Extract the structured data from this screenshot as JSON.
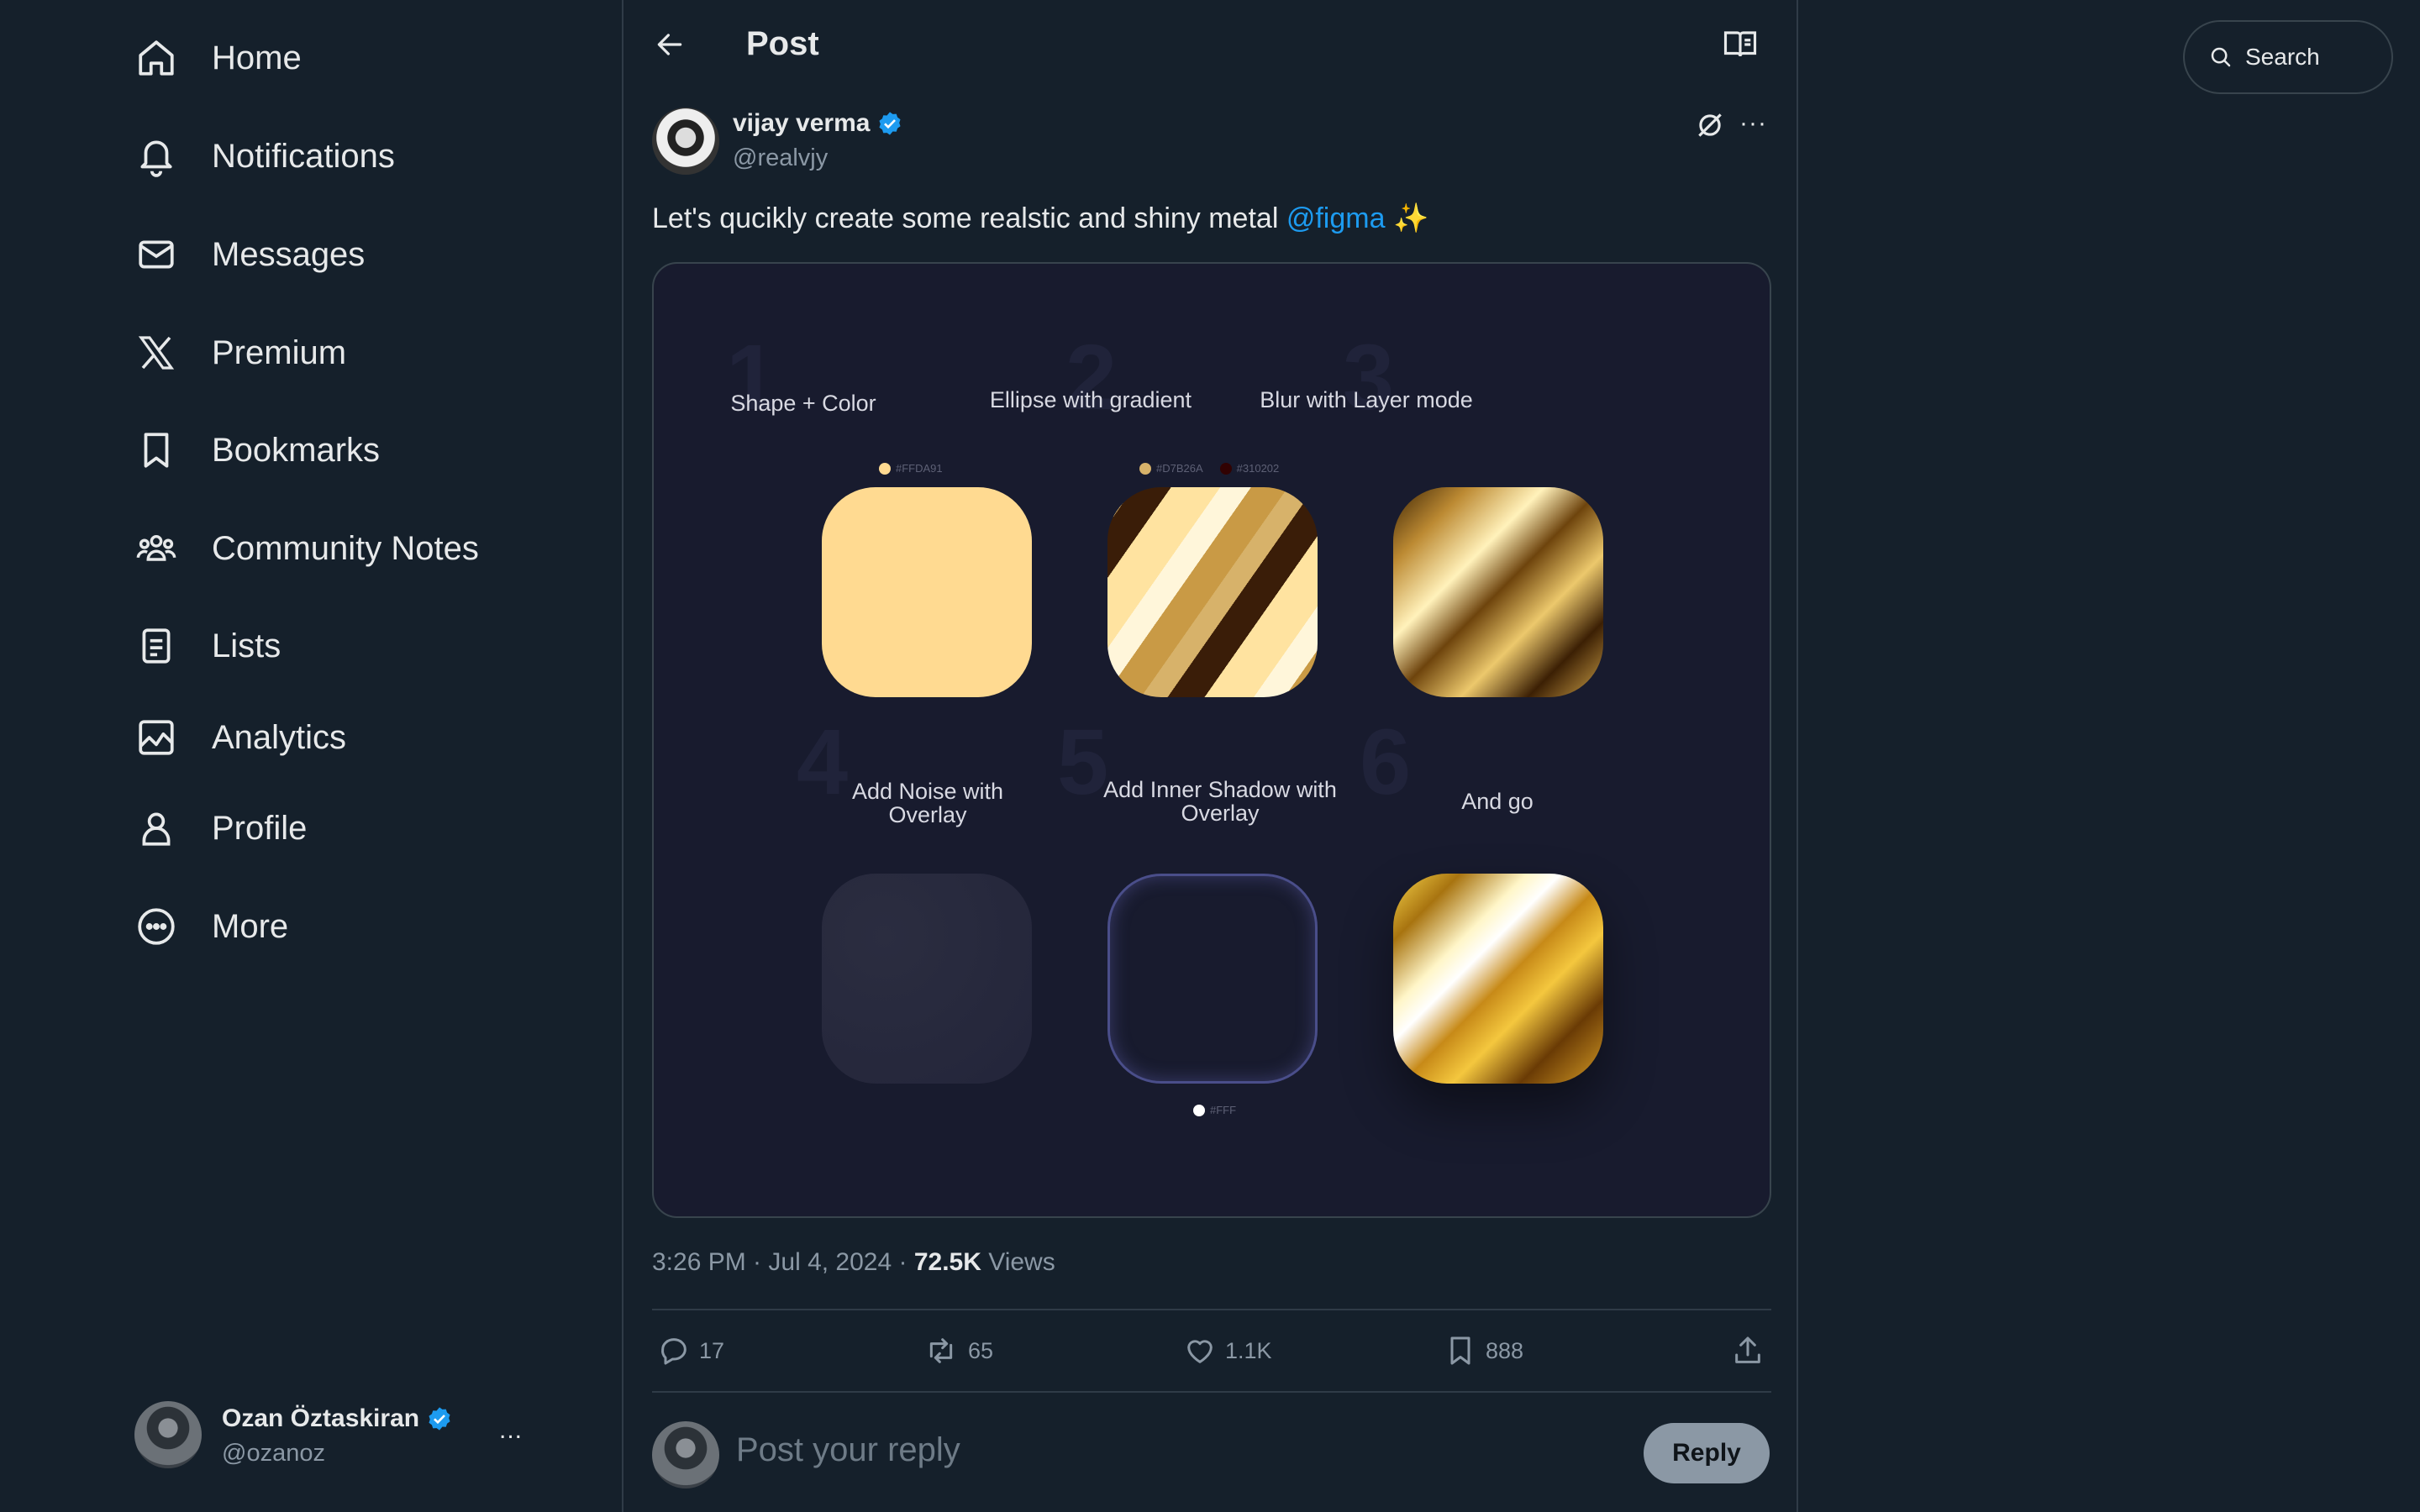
{
  "sidebar": {
    "items": [
      {
        "label": "Home",
        "icon": "home-icon"
      },
      {
        "label": "Notifications",
        "icon": "bell-icon"
      },
      {
        "label": "Messages",
        "icon": "envelope-icon"
      },
      {
        "label": "Premium",
        "icon": "x-logo-icon"
      },
      {
        "label": "Bookmarks",
        "icon": "bookmark-icon"
      },
      {
        "label": "Community Notes",
        "icon": "people-icon"
      },
      {
        "label": "Lists",
        "icon": "list-icon"
      },
      {
        "label": "Analytics",
        "icon": "analytics-icon"
      },
      {
        "label": "Profile",
        "icon": "person-icon"
      },
      {
        "label": "More",
        "icon": "more-circle-icon"
      }
    ],
    "account": {
      "name": "Ozan Öztaskiran",
      "handle": "@ozanoz",
      "more": "..."
    }
  },
  "header": {
    "title": "Post"
  },
  "post": {
    "author": "vijay verma",
    "handle": "@realvjy",
    "text_prefix": "Let's qucikly create some realstic and shiny metal ",
    "mention": "@figma",
    "emoji": "✨",
    "more": "···",
    "media": {
      "steps": [
        {
          "num": "1",
          "title": "Shape + Color",
          "swatches": [
            {
              "color": "#FFDA91",
              "label": "#FFDA91"
            }
          ]
        },
        {
          "num": "2",
          "title": "Ellipse with gradient",
          "swatches": [
            {
              "color": "#D7B26A",
              "label": "#D7B26A"
            },
            {
              "color": "#310202",
              "label": "#310202"
            }
          ]
        },
        {
          "num": "3",
          "title": "Blur with Layer mode",
          "swatches": []
        },
        {
          "num": "4",
          "title": "Add Noise with Overlay",
          "swatches": []
        },
        {
          "num": "5",
          "title": "Add Inner Shadow with Overlay",
          "swatches": [
            {
              "color": "#FFFFFF",
              "label": "#FFF"
            }
          ]
        },
        {
          "num": "6",
          "title": "And go",
          "swatches": []
        }
      ]
    },
    "meta": {
      "time": "3:26 PM · Jul 4, 2024 · ",
      "views": "72.5K",
      "views_label": " Views"
    },
    "stats": {
      "replies": "17",
      "reposts": "65",
      "likes": "1.1K",
      "bookmarks": "888"
    }
  },
  "reply": {
    "placeholder": "Post your reply",
    "button": "Reply"
  },
  "search": {
    "placeholder": "Search"
  },
  "colors": {
    "accent": "#1d9bf0",
    "background": "#15202b",
    "verified": "#1d9bf0"
  }
}
